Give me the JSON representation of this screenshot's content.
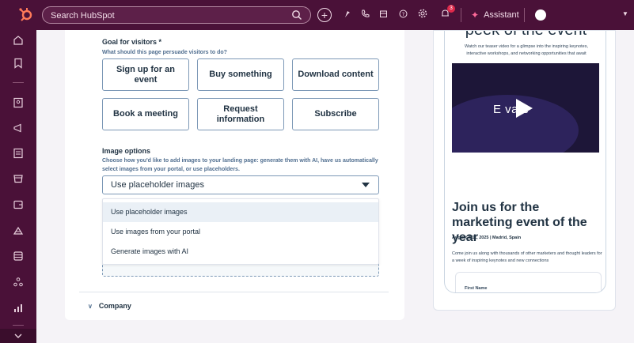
{
  "topbar": {
    "search_placeholder": "Search HubSpot",
    "notification_count": "3",
    "assistant_label": "Assistant"
  },
  "form": {
    "goal": {
      "label": "Goal for visitors *",
      "help": "What should this page persuade visitors to do?",
      "options": [
        "Sign up for an event",
        "Buy something",
        "Download content",
        "Book a meeting",
        "Request information",
        "Subscribe"
      ]
    },
    "image_options": {
      "label": "Image options",
      "help": "Choose how you'd like to add images to your landing page: generate them with AI, have us automatically select images from your portal, or use placeholders.",
      "selected": "Use placeholder images",
      "menu": [
        "Use placeholder images",
        "Use images from your portal",
        "Generate images with AI"
      ]
    },
    "company_section": "Company"
  },
  "preview": {
    "hero_title": "peek of the event",
    "teaser": "Watch our teaser video for a glimpse into the inspiring keynotes, interactive workshops, and networking opportunities that await",
    "video_brand": "E  vate",
    "event_title": "Join us for the marketing event of the year",
    "event_date": "August 4-11, 2025 | Madrid, Spain",
    "event_desc": "Come join us along with thousands of other marketers and thought leaders for a week of inspiring keynotes and new connections",
    "form_field": "First Name"
  },
  "colors": {
    "nav_bg": "#4a1138",
    "accent": "#ff7a59",
    "text": "#213343",
    "border": "#7c98b6",
    "menu_active": "#eaf0f6"
  }
}
